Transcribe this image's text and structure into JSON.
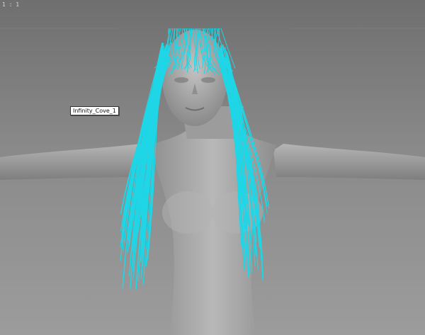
{
  "viewport": {
    "frame_label": "1 : 1",
    "background_color": "#8a8a8a"
  },
  "model": {
    "skin_color": "#a7a7a7",
    "hair_color": "#1fd6e6"
  },
  "object_tag": {
    "label": "Infinity_Cove_1"
  }
}
